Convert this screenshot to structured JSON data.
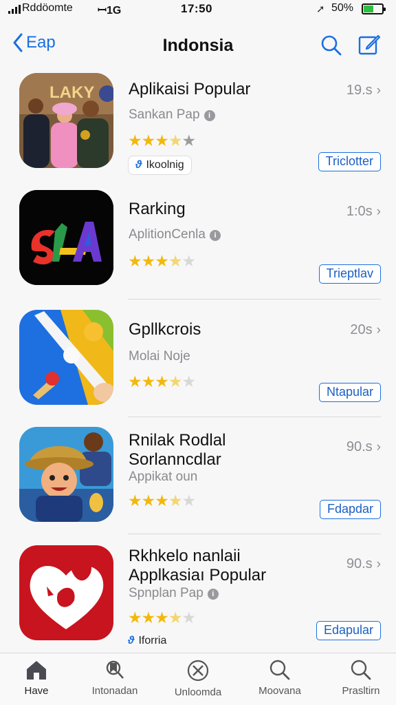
{
  "status_bar": {
    "carrier": "Rddöomte",
    "network": "ꟷ1G",
    "time": "17:50",
    "battery_percent": "50%",
    "battery_level": 0.5,
    "battery_color": "#2fbf40"
  },
  "nav": {
    "back_label": "Eap",
    "title": "Indonsia",
    "accent_color": "#1a6fe0",
    "search_icon": "search-icon",
    "compose_icon": "compose-icon"
  },
  "apps": [
    {
      "title": "Aplikaisi Popular",
      "subtitle": "Sankan Pap",
      "rating": 3,
      "size": "19.s",
      "button": "Triclotter",
      "tag": "Ikoolnig",
      "icon": "people-photo-icon"
    },
    {
      "title": "Rarking",
      "subtitle": "AplitionCenla",
      "rating": 3.5,
      "size": "1:0s",
      "button": "Trieptlav",
      "icon": "colorful-letters-icon"
    },
    {
      "title": "Gpllkcrois",
      "subtitle": "Molai Noje",
      "rating": 3.5,
      "size": "20s",
      "button": "Ntapular",
      "icon": "stick-game-icon"
    },
    {
      "title_line1": "Rnilak Rodlal",
      "title_line2": "Sorlanncdlar",
      "subtitle": "Appikat oun",
      "rating": 3.5,
      "size": "90.s",
      "button": "Fdapdar",
      "icon": "cartoon-character-icon"
    },
    {
      "title_line1": "Rkhkelo nanlaii",
      "title_line2": "Applkasiaı Popular",
      "subtitle": "Spnplan Pap",
      "rating": 3.5,
      "size": "90.s",
      "button": "Edapular",
      "tag": "Iforria",
      "icon": "red-heart-icon"
    }
  ],
  "tabs": [
    {
      "label": "Have",
      "icon": "home-icon"
    },
    {
      "label": "Intonadan",
      "icon": "bookmark-icon"
    },
    {
      "label": "Unloomda",
      "icon": "close-circle-icon"
    },
    {
      "label": "Moovana",
      "icon": "search-icon"
    },
    {
      "label": "Prasltirn",
      "icon": "search-icon"
    }
  ]
}
